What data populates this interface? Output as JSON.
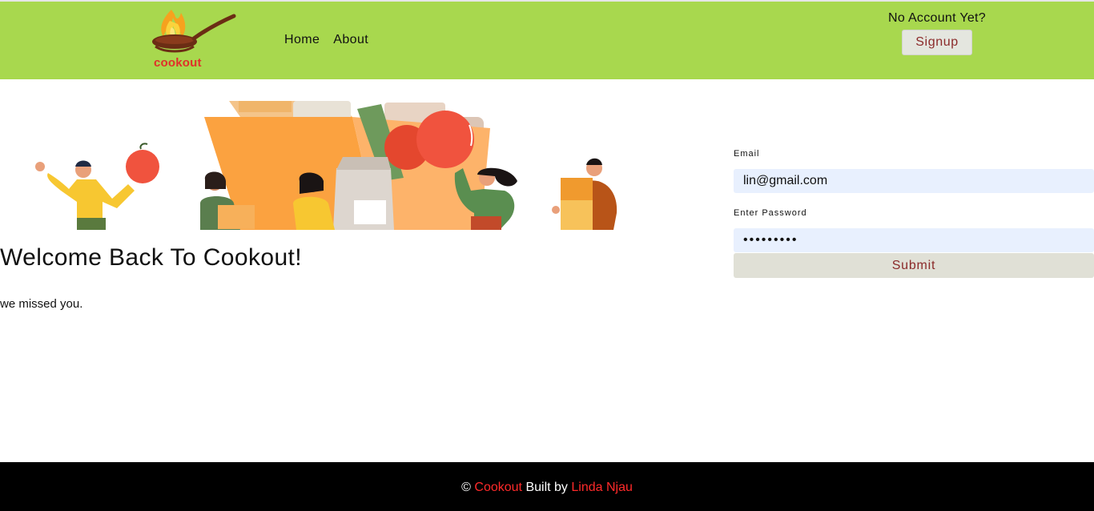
{
  "brand": {
    "name": "cookout"
  },
  "nav": {
    "items": [
      "Home",
      "About"
    ]
  },
  "account": {
    "prompt": "No Account Yet?",
    "signup_label": "Signup"
  },
  "main": {
    "heading": "Welcome Back To Cookout!",
    "subtext": "we missed you."
  },
  "form": {
    "email_label": "Email",
    "email_value": "lin@gmail.com",
    "password_label": "Enter Password",
    "password_value": "•••••••••",
    "submit_label": "Submit"
  },
  "footer": {
    "copy": "©",
    "brand": "Cookout",
    "built_by": "Built by",
    "author": "Linda Njau"
  },
  "colors": {
    "header": "#a8d84e",
    "accent_red": "#ff2a2a",
    "button_text": "#8b2a2a",
    "input_bg": "#e8f0fe"
  }
}
